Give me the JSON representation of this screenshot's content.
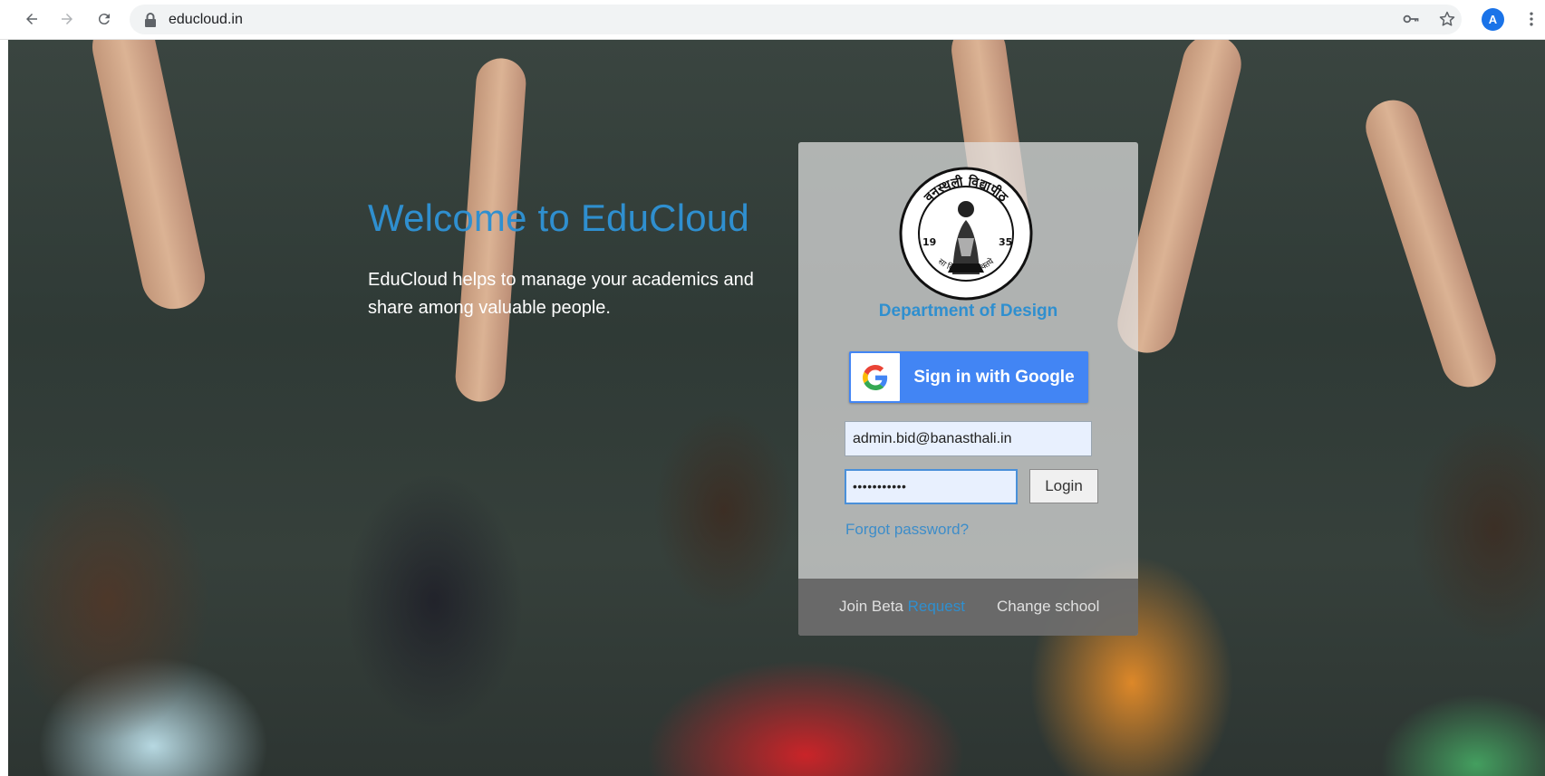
{
  "browser": {
    "url": "educloud.in",
    "avatar_letter": "A",
    "icons": [
      "back-icon",
      "forward-icon",
      "reload-icon",
      "lock-icon",
      "key-icon",
      "star-icon",
      "menu-icon"
    ]
  },
  "welcome": {
    "title": "Welcome to EduCloud",
    "text": "EduCloud helps to manage your academics and share among valuable people."
  },
  "login_card": {
    "seal_text_top": "वनस्थली विद्यापीठ",
    "seal_text_bottom": "सा विद्या या विमुक्तये",
    "seal_year_left": "19",
    "seal_year_right": "35",
    "department": "Department of Design",
    "google_button_label": "Sign in with Google",
    "email_value": "admin.bid@banasthali.in",
    "password_value": "•••••••••••",
    "login_label": "Login",
    "forgot_label": "Forgot password?",
    "join_beta_label": "Join Beta",
    "request_label": "Request",
    "change_school_label": "Change school"
  },
  "colors": {
    "accent": "#2f8fcf",
    "google_blue": "#4285f4"
  }
}
